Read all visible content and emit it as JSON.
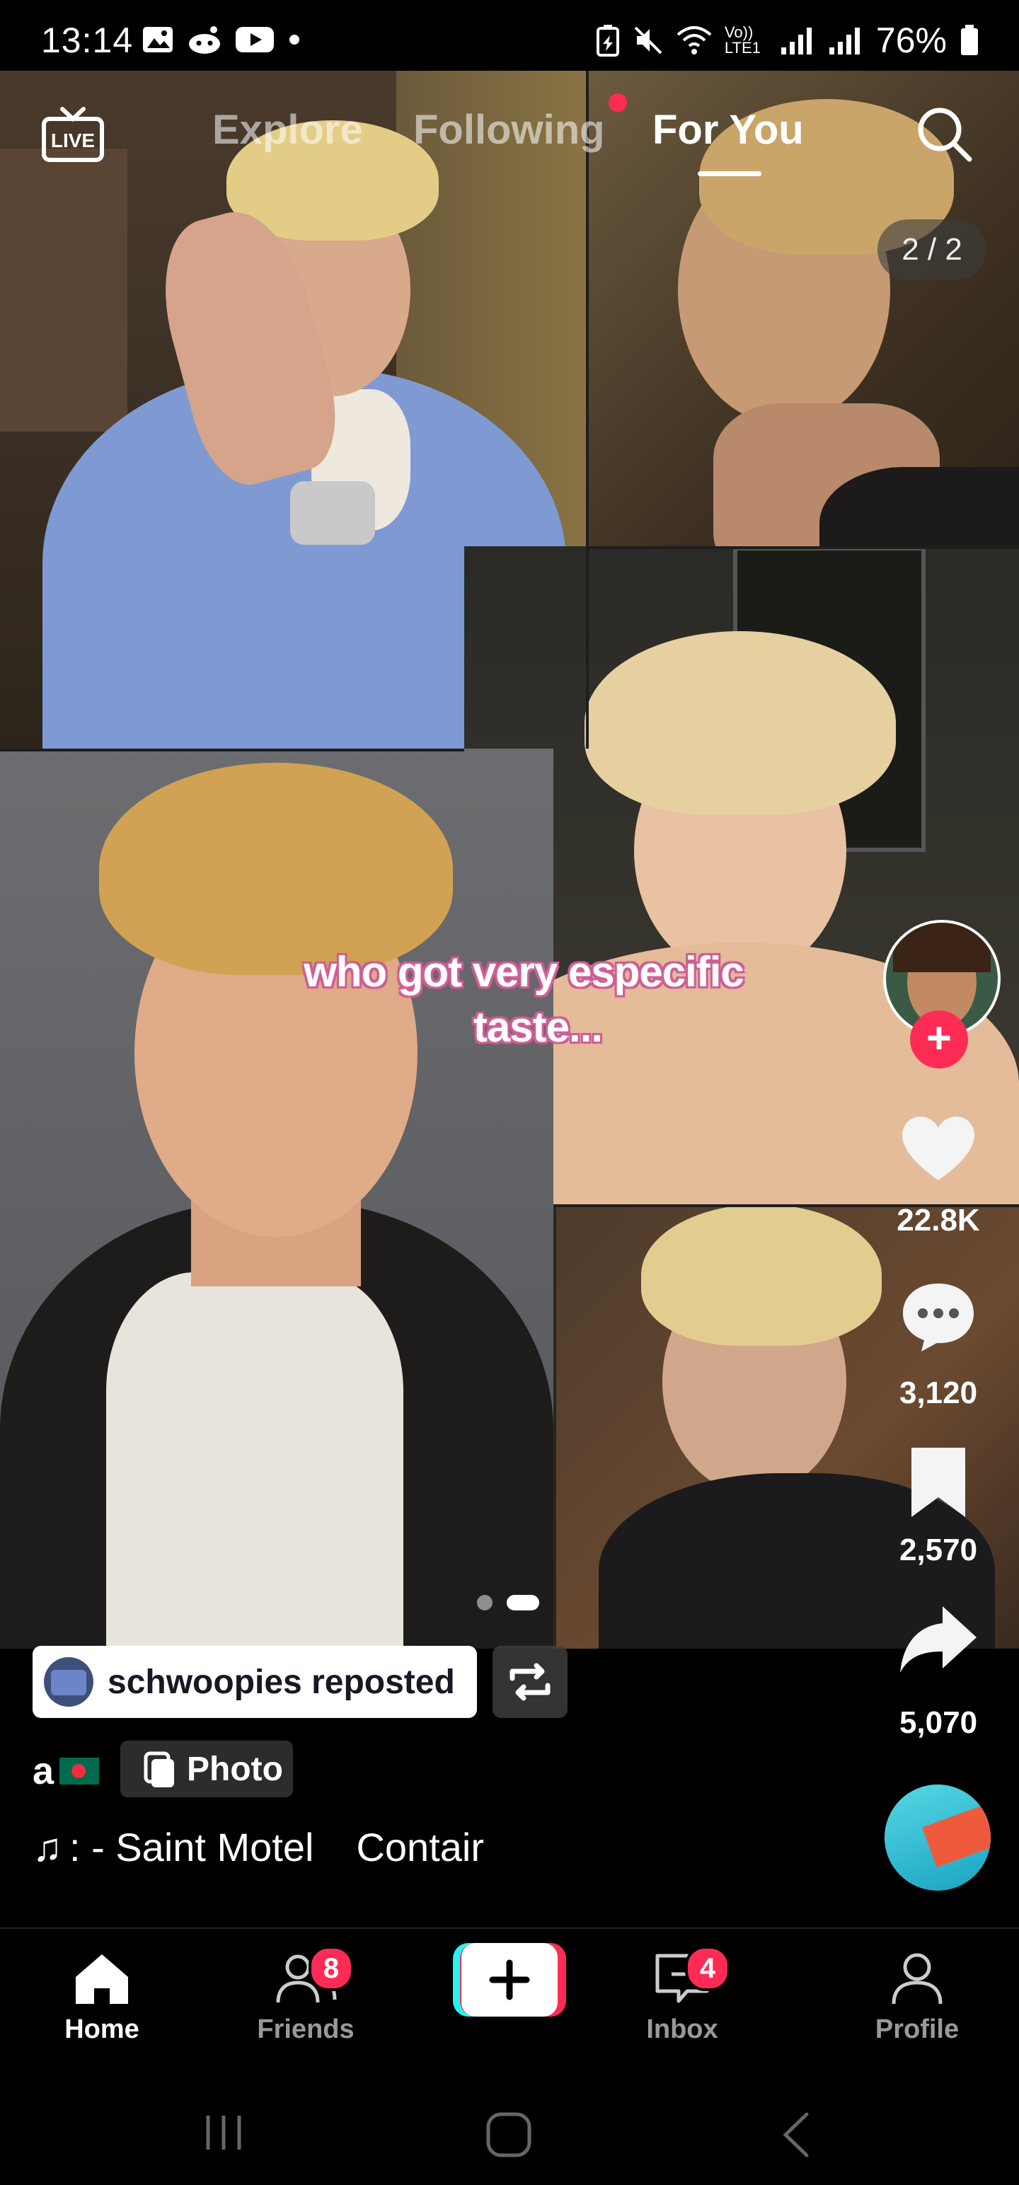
{
  "status_bar": {
    "time": "13:14",
    "battery": "76%",
    "network_label": "Vo)) LTE1",
    "network_gen": "6"
  },
  "top_nav": {
    "live_label": "LIVE",
    "tabs": [
      {
        "label": "Explore",
        "active": false
      },
      {
        "label": "Following",
        "active": false,
        "has_dot": true
      },
      {
        "label": "For You",
        "active": true
      }
    ]
  },
  "post": {
    "photo_counter": "2 / 2",
    "caption_line1": "who got very especific",
    "caption_line2": "taste...",
    "likes": "22.8K",
    "comments": "3,120",
    "bookmarks": "2,570",
    "shares": "5,070",
    "carousel_index": 2,
    "carousel_total": 2,
    "repost_text": "schwoopies reposted",
    "username": "a",
    "photo_tag": "Photo",
    "music_prefix": "♫",
    "music_title": ": - Saint Motel",
    "music_extra": "Contair"
  },
  "bottom_nav": {
    "items": [
      {
        "label": "Home",
        "active": true
      },
      {
        "label": "Friends",
        "badge": "8"
      },
      {
        "label": "",
        "create": true
      },
      {
        "label": "Inbox",
        "badge": "4"
      },
      {
        "label": "Profile"
      }
    ]
  },
  "colors": {
    "accent": "#fe2c55",
    "cyan": "#25f4ee",
    "caption_pink": "#c95a92"
  }
}
